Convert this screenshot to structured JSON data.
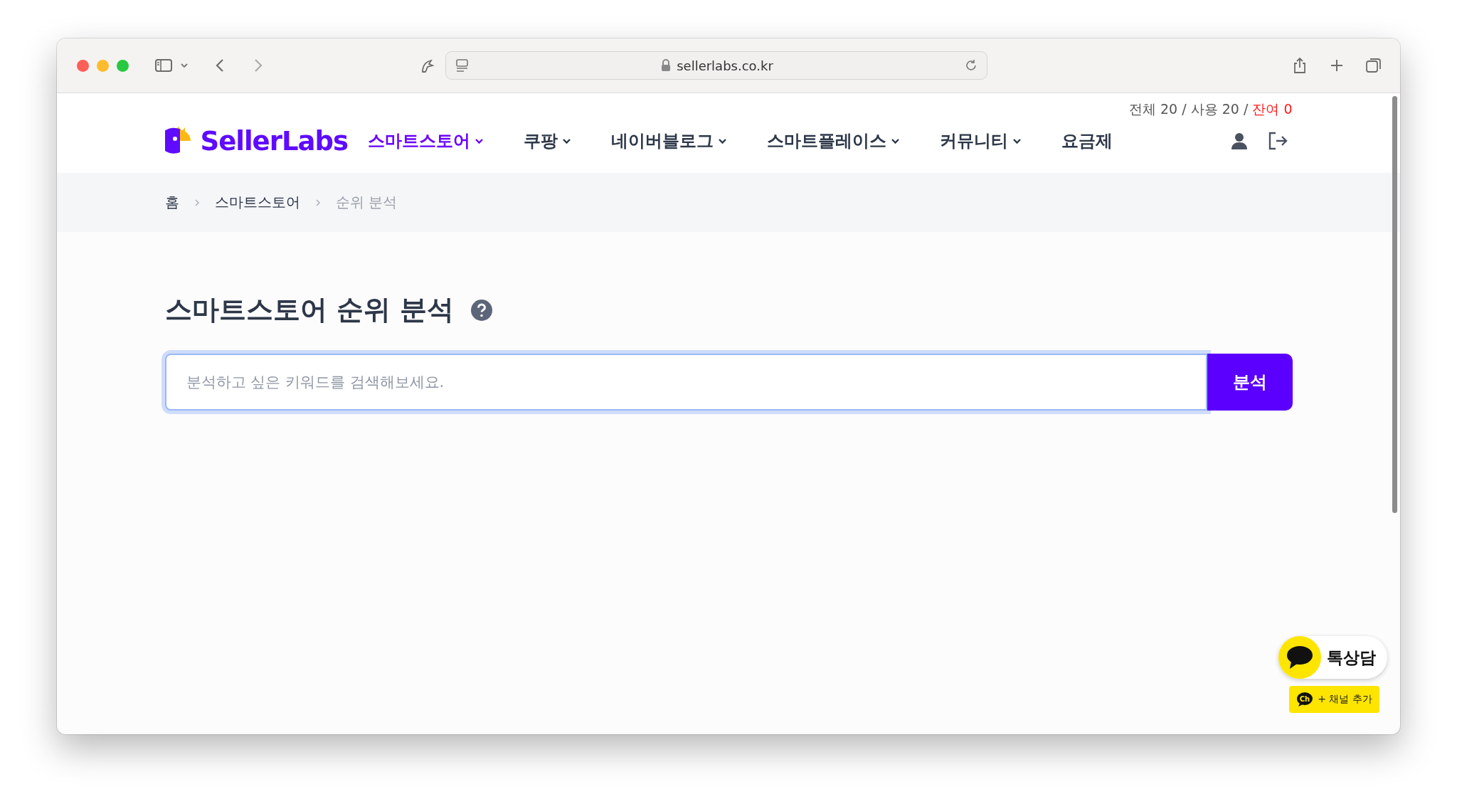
{
  "browser": {
    "url": "sellerlabs.co.kr"
  },
  "header": {
    "logo": "SellerLabs",
    "usage": [
      {
        "kind": "plain",
        "text": "전체 20 / 사용 20 / "
      },
      {
        "kind": "alert",
        "text": "잔여 0"
      }
    ],
    "nav": [
      {
        "label": "스마트스토어",
        "selected": true,
        "caret": true
      },
      {
        "label": "쿠팡",
        "selected": false,
        "caret": true
      },
      {
        "label": "네이버블로그",
        "selected": false,
        "caret": true
      },
      {
        "label": "스마트플레이스",
        "selected": false,
        "caret": true
      },
      {
        "label": "커뮤니티",
        "selected": false,
        "caret": true
      },
      {
        "label": "요금제",
        "selected": false,
        "caret": false
      }
    ]
  },
  "breadcrumb": [
    {
      "label": "홈",
      "current": false
    },
    {
      "label": "스마트스토어",
      "current": false
    },
    {
      "label": "순위 분석",
      "current": true
    }
  ],
  "page_title": "스마트스토어 순위 분석",
  "search": {
    "placeholder": "분석하고 싶은 키워드를 검색해보세요.",
    "button": "분석"
  },
  "chat_widget": {
    "label": "톡상담",
    "channel_icon": "Ch",
    "channel_button": "+ 채널 추가"
  }
}
